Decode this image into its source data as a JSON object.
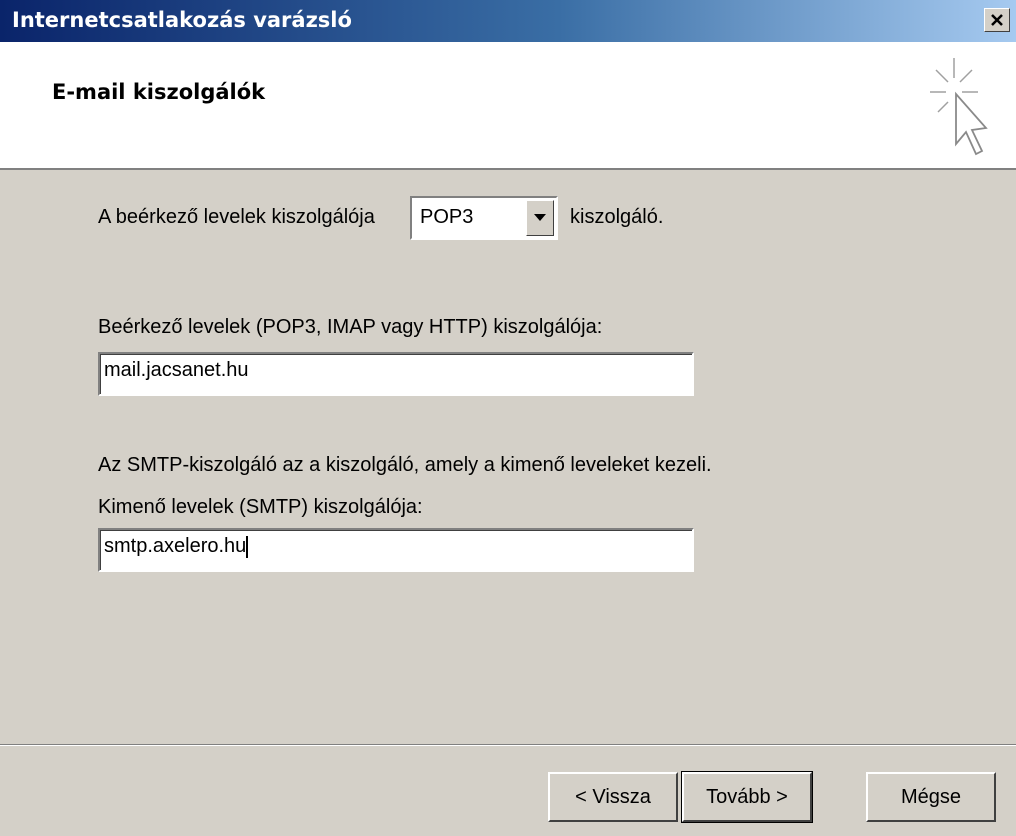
{
  "window": {
    "title": "Internetcsatlakozás varázsló",
    "close_glyph": "✕"
  },
  "header": {
    "heading": "E-mail kiszolgálók",
    "icon": "wizard-sparkle-cursor-icon"
  },
  "form": {
    "incoming_type_prefix": "A beérkező levelek kiszolgálója",
    "incoming_type_value": "POP3",
    "incoming_type_suffix": "kiszolgáló.",
    "incoming_server_label": "Beérkező levelek (POP3, IMAP vagy HTTP) kiszolgálója:",
    "incoming_server_value": "mail.jacsanet.hu",
    "smtp_description": "Az SMTP-kiszolgáló az a kiszolgáló, amely a kimenő leveleket kezeli.",
    "outgoing_server_label": "Kimenő levelek (SMTP) kiszolgálója:",
    "outgoing_server_value": "smtp.axelero.hu"
  },
  "buttons": {
    "back": "< Vissza",
    "next": "Tovább >",
    "cancel": "Mégse"
  }
}
